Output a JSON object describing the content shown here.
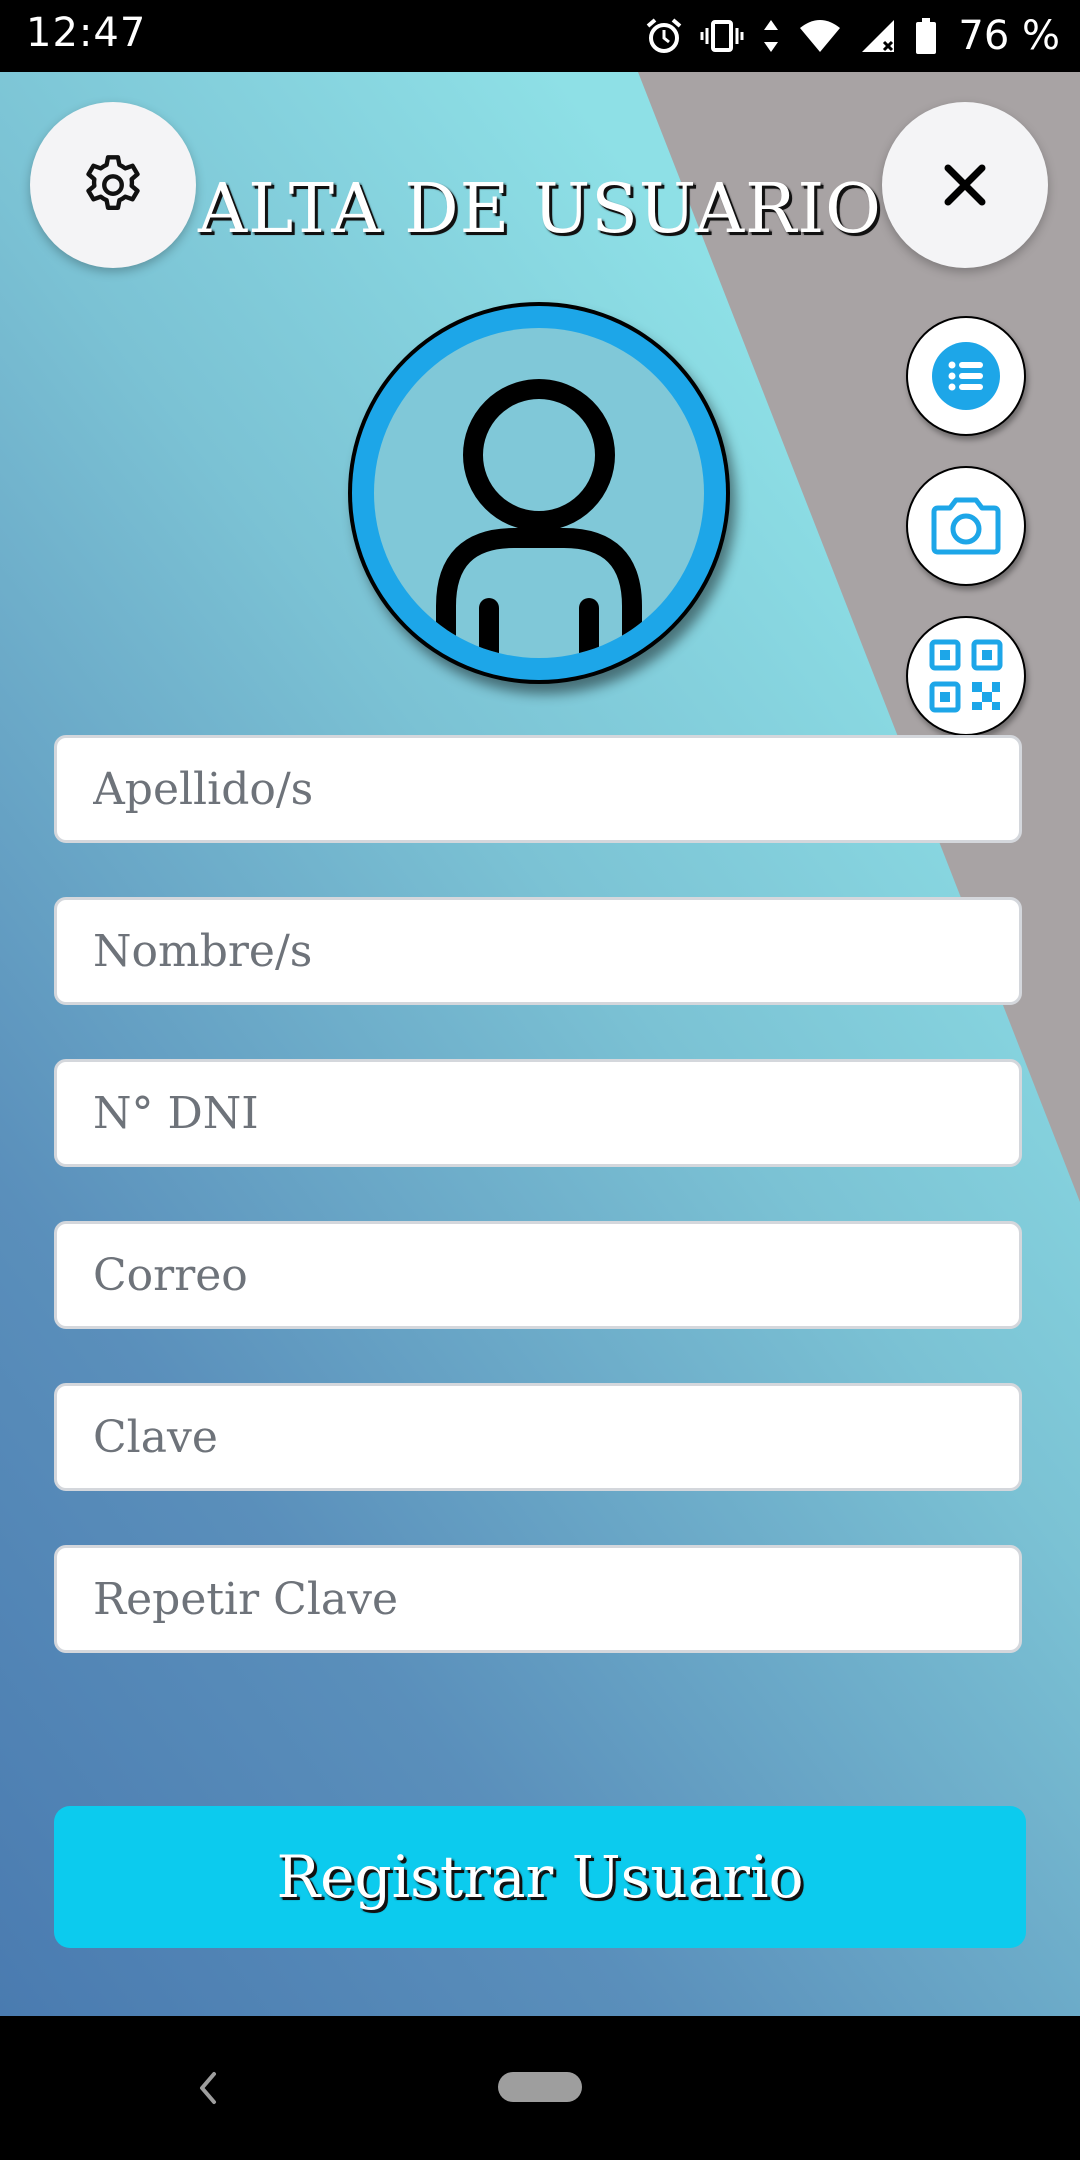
{
  "status_bar": {
    "time": "12:47",
    "battery": "76 %",
    "icons": [
      "alarm-icon",
      "vibrate-icon",
      "data-arrows-icon",
      "wifi-icon",
      "cell-signal-icon",
      "battery-icon"
    ]
  },
  "header": {
    "title": "ALTA DE USUARIO",
    "settings_icon": "gear-icon",
    "close_icon": "close-icon"
  },
  "avatar": {
    "icon": "user-icon"
  },
  "side_actions": [
    {
      "icon": "list-icon"
    },
    {
      "icon": "camera-icon"
    },
    {
      "icon": "qr-code-icon"
    }
  ],
  "form": {
    "apellido_placeholder": "Apellido/s",
    "nombre_placeholder": "Nombre/s",
    "dni_placeholder": "N° DNI",
    "correo_placeholder": "Correo",
    "clave_placeholder": "Clave",
    "repetir_clave_placeholder": "Repetir Clave",
    "submit_label": "Registrar Usuario"
  },
  "colors": {
    "accent": "#0ccbee",
    "icon_blue": "#1da6e8",
    "grey_shape": "#a8a3a4"
  }
}
